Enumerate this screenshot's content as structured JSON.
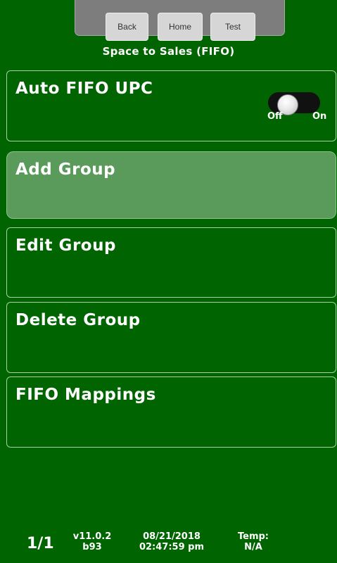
{
  "nav": {
    "back_label": "Back",
    "home_label": "Home",
    "test_label": "Test"
  },
  "screen_title": "Space to Sales (FIFO)",
  "menu": [
    {
      "label": "Auto FIFO UPC"
    },
    {
      "label": "Add Group"
    },
    {
      "label": "Edit Group"
    },
    {
      "label": "Delete Group"
    },
    {
      "label": "FIFO Mappings"
    }
  ],
  "toggle": {
    "off_label": "Off",
    "on_label": "On",
    "state": "off"
  },
  "footer": {
    "page": "1/1",
    "version": "v11.0.2",
    "build": "b93",
    "date": "08/21/2018",
    "time": "02:47:59 pm",
    "temp_label": "Temp:",
    "temp_value": "N/A"
  },
  "colors": {
    "background": "#006400",
    "active_tile": "#5a9a5a",
    "toolbar": "#7d7d7d"
  }
}
